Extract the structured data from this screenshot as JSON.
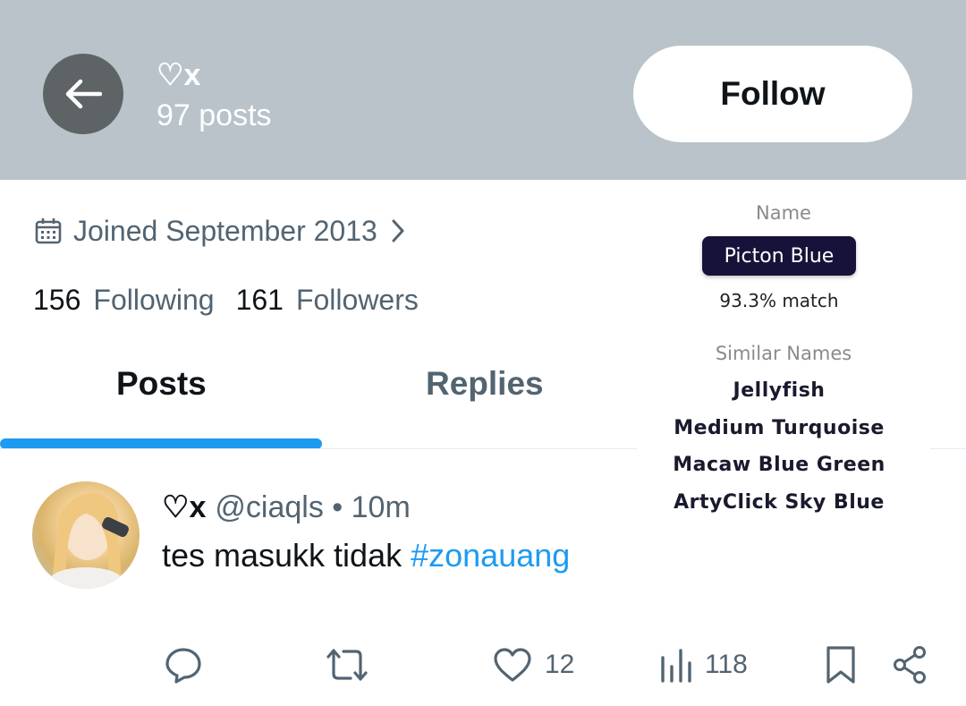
{
  "header": {
    "back_icon": "arrow-left-icon",
    "name": "♡x",
    "posts_count": "97 posts",
    "follow_label": "Follow"
  },
  "profile": {
    "calendar_icon": "calendar-icon",
    "joined": "Joined September 2013",
    "following_count": "156",
    "following_label": "Following",
    "followers_count": "161",
    "followers_label": "Followers"
  },
  "tabs": [
    {
      "label": "Posts",
      "active": true
    },
    {
      "label": "Replies",
      "active": false
    }
  ],
  "tweet": {
    "name": "♡x",
    "handle_time": "@ciaqls • 10m",
    "text": "tes masukk tidak ",
    "hashtag": "#zonauang",
    "actions": {
      "reply_icon": "reply-icon",
      "retweet_icon": "retweet-icon",
      "like_icon": "heart-icon",
      "like_count": "12",
      "views_icon": "bar-chart-icon",
      "views_count": "118",
      "bookmark_icon": "bookmark-icon",
      "share_icon": "share-icon"
    }
  },
  "color_picker": {
    "name_label": "Name",
    "color_name": "Picton Blue",
    "match": "93.3% match",
    "similar_label": "Similar Names",
    "similar": [
      "Jellyfish",
      "Medium Turquoise",
      "Macaw Blue Green",
      "ArtyClick Sky Blue"
    ]
  },
  "colors": {
    "header_bg": "#b9c3c9",
    "accent": "#1d9bf0",
    "text_primary": "#0f1419",
    "text_secondary": "#536471",
    "pill_bg": "#16123a"
  }
}
